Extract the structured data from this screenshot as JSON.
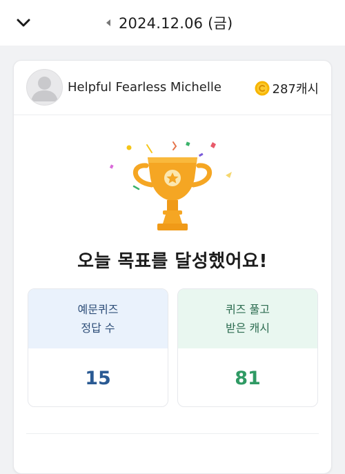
{
  "header": {
    "date": "2024.12.06 (금)",
    "collapse_icon": "chevron-down-icon",
    "prev_icon": "triangle-left-icon"
  },
  "profile": {
    "name": "Helpful Fearless Michelle",
    "cash": "287캐시",
    "avatar_icon": "user-avatar-icon",
    "coin_icon": "coin-icon"
  },
  "achievement": {
    "title": "오늘 목표를 달성했어요!",
    "icon": "trophy-icon"
  },
  "stats": [
    {
      "label_line1": "예문퀴즈",
      "label_line2": "정답 수",
      "value": "15"
    },
    {
      "label_line1": "퀴즈 풀고",
      "label_line2": "받은 캐시",
      "value": "81"
    }
  ],
  "colors": {
    "trophy": "#f5a623",
    "coin": "#f7b500",
    "quiz_value": "#2a5a93",
    "cash_value": "#2f9a64"
  }
}
